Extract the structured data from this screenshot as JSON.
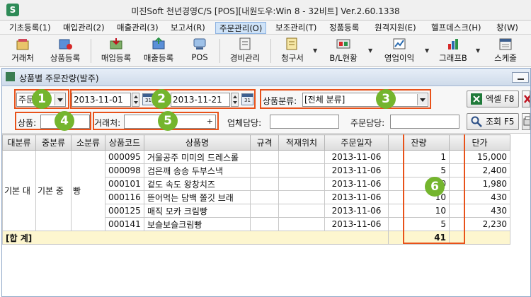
{
  "window": {
    "title": "미진Soft 천년경영C/S [POS][내원도우:Win 8 - 32비트] Ver.2.60.1338"
  },
  "menu": {
    "items": [
      {
        "label": "기초등록(1)",
        "active": false
      },
      {
        "label": "매입관리(2)",
        "active": false
      },
      {
        "label": "매출관리(3)",
        "active": false
      },
      {
        "label": "보고서(R)",
        "active": false
      },
      {
        "label": "주문관리(O)",
        "active": true
      },
      {
        "label": "보조관리(T)",
        "active": false
      },
      {
        "label": "정품등록",
        "active": false
      },
      {
        "label": "원격지원(E)",
        "active": false
      },
      {
        "label": "헬프데스크(H)",
        "active": false
      },
      {
        "label": "창(W)",
        "active": false
      }
    ]
  },
  "toolbar": {
    "buttons": [
      {
        "label": "거래처",
        "icon": "vendor-icon"
      },
      {
        "label": "상품등록",
        "icon": "product-icon"
      },
      {
        "label": "매입등록",
        "icon": "purchase-icon"
      },
      {
        "label": "매출등록",
        "icon": "sales-icon"
      },
      {
        "label": "POS",
        "icon": "pos-icon"
      },
      {
        "label": "경비관리",
        "icon": "expense-icon"
      },
      {
        "label": "청구서",
        "icon": "invoice-icon"
      },
      {
        "label": "B/L현황",
        "icon": "bl-status-icon"
      },
      {
        "label": "영업이익",
        "icon": "profit-icon"
      },
      {
        "label": "그래프B",
        "icon": "graph-icon"
      },
      {
        "label": "스케줄",
        "icon": "schedule-icon"
      }
    ]
  },
  "panel": {
    "title": "상품별 주문잔량(발주)"
  },
  "filters": {
    "period_select": "주문일",
    "date_from": "2013-11-01",
    "date_to": "2013-11-21",
    "calendar_glyph": "31",
    "category_label": "상품분류:",
    "category_value": "[전체 분류]",
    "product_label": "상품:",
    "product_value": "",
    "vendor_label": "거래처:",
    "vendor_value": "",
    "vendor_plus": "+",
    "biz_manager_label": "업체담당:",
    "biz_manager_value": "",
    "order_manager_label": "주문담당:",
    "order_manager_value": "",
    "excel_label": "엑셀 F8",
    "search_label": "조회 F5"
  },
  "annotations": [
    "1",
    "2",
    "3",
    "4",
    "5",
    "6"
  ],
  "table": {
    "columns": [
      "대분류",
      "중분류",
      "소분류",
      "상품코드",
      "상품명",
      "규격",
      "적재위치",
      "주문일자",
      "잔량",
      "단가"
    ],
    "group": {
      "major": "기본 대",
      "middle": "기본 중",
      "minor": "빵"
    },
    "rows": [
      {
        "code": "000095",
        "name": "거울공주 미미의 드레스롤",
        "spec": "",
        "location": "",
        "date": "2013-11-06",
        "remain": "1",
        "price": "15,000"
      },
      {
        "code": "000098",
        "name": "검은깨 송송 두부스낵",
        "spec": "",
        "location": "",
        "date": "2013-11-06",
        "remain": "5",
        "price": "2,400"
      },
      {
        "code": "000101",
        "name": "겉도 속도 왕창치즈",
        "spec": "",
        "location": "",
        "date": "2013-11-06",
        "remain": "10",
        "price": "1,980"
      },
      {
        "code": "000116",
        "name": "뜯어먹는 담백 쫄깃 브래",
        "spec": "",
        "location": "",
        "date": "2013-11-06",
        "remain": "10",
        "price": "430"
      },
      {
        "code": "000125",
        "name": "매직 모카 크림빵",
        "spec": "",
        "location": "",
        "date": "2013-11-06",
        "remain": "10",
        "price": "430"
      },
      {
        "code": "000141",
        "name": "보슬보슬크림빵",
        "spec": "",
        "location": "",
        "date": "2013-11-06",
        "remain": "5",
        "price": "2,230"
      }
    ],
    "total": {
      "label": "[합 계]",
      "remain": "41"
    }
  }
}
